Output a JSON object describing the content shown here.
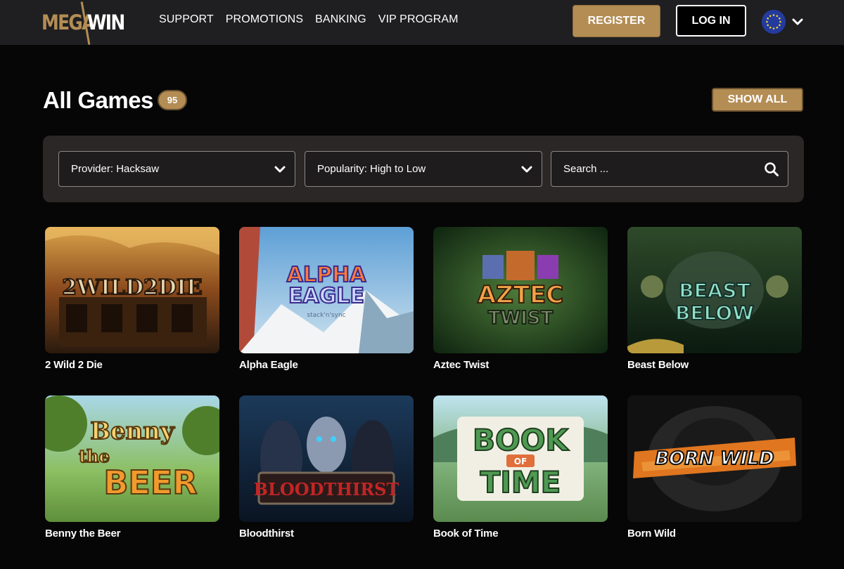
{
  "header": {
    "logo": {
      "mega": "MEGA",
      "win": "WIN"
    },
    "nav": [
      "SUPPORT",
      "PROMOTIONS",
      "BANKING",
      "VIP PROGRAM"
    ],
    "register_label": "REGISTER",
    "login_label": "LOG IN",
    "language_icon": "eu-flag-icon"
  },
  "main": {
    "title": "All Games",
    "count": "95",
    "show_all_label": "SHOW ALL"
  },
  "filters": {
    "provider": "Provider: Hacksaw",
    "sort": "Popularity: High to Low",
    "search_placeholder": "Search ..."
  },
  "games": [
    {
      "title": "2 Wild 2 Die",
      "art_text": "2WILD2DIE"
    },
    {
      "title": "Alpha Eagle",
      "art_text": "ALPHA EAGLE",
      "art_sub": "stack'n'sync"
    },
    {
      "title": "Aztec Twist",
      "art_text": "AZTEC TWIST"
    },
    {
      "title": "Beast Below",
      "art_text": "BEAST BELOW"
    },
    {
      "title": "Benny the Beer",
      "art_text": "Benny the BEER"
    },
    {
      "title": "Bloodthirst",
      "art_text": "BLOODTHIRST"
    },
    {
      "title": "Book of Time",
      "art_text": "BOOK OF TIME"
    },
    {
      "title": "Born Wild",
      "art_text": "BORN WILD"
    }
  ],
  "colors": {
    "accent": "#b48d54",
    "header_bg": "#1f1f21",
    "page_bg": "#060606",
    "panel_bg": "#2a2726"
  }
}
